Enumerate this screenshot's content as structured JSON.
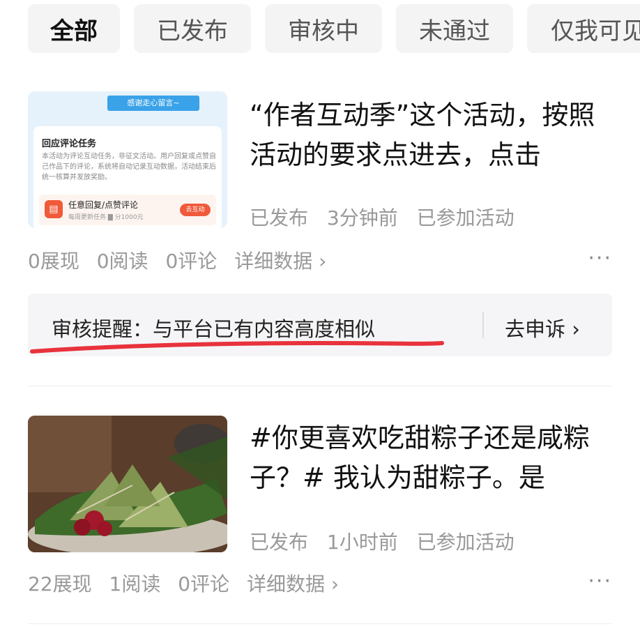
{
  "tabs": [
    {
      "label": "全部",
      "active": true
    },
    {
      "label": "已发布",
      "active": false
    },
    {
      "label": "审核中",
      "active": false
    },
    {
      "label": "未通过",
      "active": false
    },
    {
      "label": "仅我可见",
      "active": false
    }
  ],
  "articles": [
    {
      "title": "“作者互动季”这个活动，按照活动的要求点进去，点击",
      "status": "已发布",
      "time": "3分钟前",
      "activity": "已参加活动",
      "impressions": "0展现",
      "reads": "0阅读",
      "comments": "0评论",
      "detail": "详细数据 ›",
      "more": "···",
      "thumb": {
        "ribbon": "感谢走心留言~",
        "card_title": "回应评论任务",
        "card_desc": "本活动为评论互动任务，非征文活动。用户回复或点赞自己作品下的评论，系统将自动记录互动数据，活动结束后统一核算并发放奖励。",
        "task_name": "任意回复/点赞评论",
        "task_sub": "每周更新任务 ▇ 分1000元",
        "button": "去互动"
      }
    },
    {
      "title": "#你更喜欢吃甜粽子还是咸粽子？# 我认为甜粽子。是",
      "status": "已发布",
      "time": "1小时前",
      "activity": "已参加活动",
      "impressions": "22展现",
      "reads": "1阅读",
      "comments": "0评论",
      "detail": "详细数据 ›",
      "more": "···"
    }
  ],
  "review": {
    "label": "审核提醒：与平台已有内容高度相似",
    "appeal": "去申诉 ›"
  },
  "colors": {
    "underline": "#e8323c",
    "tab_bg": "#f4f4f4",
    "review_bg": "#f5f5f7"
  }
}
